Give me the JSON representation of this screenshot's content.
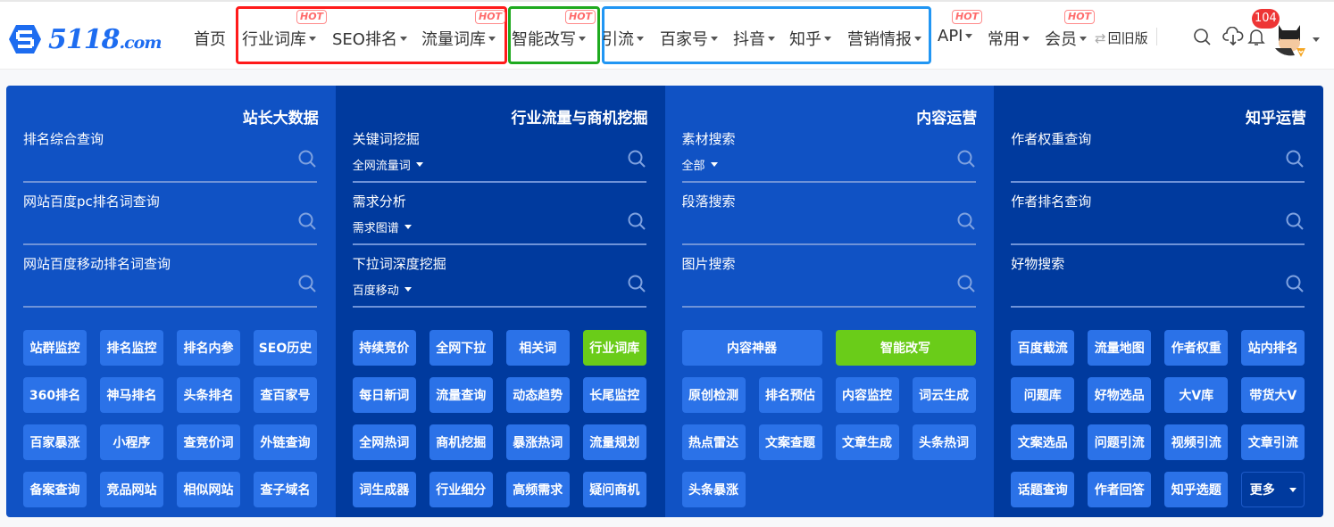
{
  "header": {
    "logo": {
      "mark": "5118",
      "suffix": ".com"
    },
    "nav": [
      {
        "label": "首页",
        "dropdown": false,
        "hot": false
      },
      {
        "label": "行业词库",
        "dropdown": true,
        "hot": true
      },
      {
        "label": "SEO排名",
        "dropdown": true,
        "hot": false
      },
      {
        "label": "流量词库",
        "dropdown": true,
        "hot": true
      },
      {
        "label": "智能改写",
        "dropdown": true,
        "hot": true
      },
      {
        "label": "引流",
        "dropdown": true,
        "hot": false
      },
      {
        "label": "百家号",
        "dropdown": true,
        "hot": false
      },
      {
        "label": "抖音",
        "dropdown": true,
        "hot": false
      },
      {
        "label": "知乎",
        "dropdown": true,
        "hot": false
      },
      {
        "label": "营销情报",
        "dropdown": true,
        "hot": false
      },
      {
        "label": "API",
        "dropdown": true,
        "hot": true
      },
      {
        "label": "常用",
        "dropdown": true,
        "hot": false
      },
      {
        "label": "会员",
        "dropdown": true,
        "hot": true
      }
    ],
    "hot_label": "HOT",
    "old_version_label": "回旧版",
    "notification_count": "104",
    "icons": [
      "search-icon",
      "cloud-download-icon",
      "bell-icon",
      "avatar"
    ]
  },
  "colors": {
    "brand": "#1d6cf0",
    "panel_light": "#1052c4",
    "panel_dark": "#003a9e",
    "button": "#2b72e8",
    "button_highlight": "#6acc19",
    "hot": "#ff6b6b",
    "badge": "#ee3535",
    "highlight_red": "#ff1a1a",
    "highlight_green": "#1faa1f",
    "highlight_blue": "#2196f3"
  },
  "panels": [
    {
      "title": "站长大数据",
      "searches": [
        {
          "label": "排名综合查询",
          "select": null
        },
        {
          "label": "网站百度pc排名词查询",
          "select": null
        },
        {
          "label": "网站百度移动排名词查询",
          "select": null
        }
      ],
      "buttons": [
        {
          "label": "站群监控"
        },
        {
          "label": "排名监控"
        },
        {
          "label": "排名内参"
        },
        {
          "label": "SEO历史"
        },
        {
          "label": "360排名"
        },
        {
          "label": "神马排名"
        },
        {
          "label": "头条排名"
        },
        {
          "label": "查百家号"
        },
        {
          "label": "百家暴涨"
        },
        {
          "label": "小程序"
        },
        {
          "label": "查竞价词"
        },
        {
          "label": "外链查询"
        },
        {
          "label": "备案查询"
        },
        {
          "label": "竞品网站"
        },
        {
          "label": "相似网站"
        },
        {
          "label": "查子域名"
        }
      ]
    },
    {
      "title": "行业流量与商机挖掘",
      "searches": [
        {
          "label": "关键词挖掘",
          "select": "全网流量词"
        },
        {
          "label": "需求分析",
          "select": "需求图谱"
        },
        {
          "label": "下拉词深度挖掘",
          "select": "百度移动"
        }
      ],
      "buttons": [
        {
          "label": "持续竞价"
        },
        {
          "label": "全网下拉"
        },
        {
          "label": "相关词"
        },
        {
          "label": "行业词库",
          "highlight": true
        },
        {
          "label": "每日新词"
        },
        {
          "label": "流量查询"
        },
        {
          "label": "动态趋势"
        },
        {
          "label": "长尾监控"
        },
        {
          "label": "全网热词"
        },
        {
          "label": "商机挖掘"
        },
        {
          "label": "暴涨热词"
        },
        {
          "label": "流量规划"
        },
        {
          "label": "词生成器"
        },
        {
          "label": "行业细分"
        },
        {
          "label": "高频需求"
        },
        {
          "label": "疑问商机"
        }
      ]
    },
    {
      "title": "内容运营",
      "searches": [
        {
          "label": "素材搜索",
          "select": "全部"
        },
        {
          "label": "段落搜索",
          "select": null
        },
        {
          "label": "图片搜索",
          "select": null
        }
      ],
      "buttons": [
        {
          "label": "内容神器",
          "wide": true
        },
        {
          "label": "智能改写",
          "wide": true,
          "highlight": true
        },
        {
          "label": "原创检测"
        },
        {
          "label": "排名预估"
        },
        {
          "label": "内容监控"
        },
        {
          "label": "词云生成"
        },
        {
          "label": "热点雷达"
        },
        {
          "label": "文案查题"
        },
        {
          "label": "文章生成"
        },
        {
          "label": "头条热词"
        },
        {
          "label": "头条暴涨"
        }
      ]
    },
    {
      "title": "知乎运营",
      "searches": [
        {
          "label": "作者权重查询",
          "select": null
        },
        {
          "label": "作者排名查询",
          "select": null
        },
        {
          "label": "好物搜索",
          "select": null
        }
      ],
      "buttons": [
        {
          "label": "百度截流"
        },
        {
          "label": "流量地图"
        },
        {
          "label": "作者权重"
        },
        {
          "label": "站内排名"
        },
        {
          "label": "问题库"
        },
        {
          "label": "好物选品"
        },
        {
          "label": "大V库"
        },
        {
          "label": "带货大V"
        },
        {
          "label": "文案选品"
        },
        {
          "label": "问题引流"
        },
        {
          "label": "视频引流"
        },
        {
          "label": "文章引流"
        },
        {
          "label": "话题查询"
        },
        {
          "label": "作者回答"
        },
        {
          "label": "知乎选题"
        },
        {
          "label": "更多",
          "more": true
        }
      ]
    }
  ]
}
